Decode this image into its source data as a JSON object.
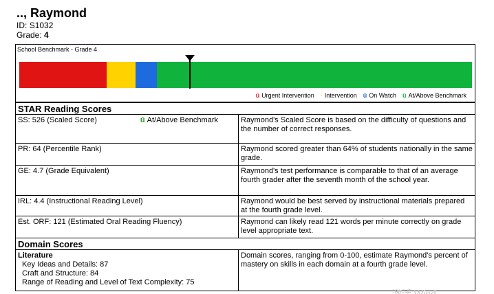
{
  "student": {
    "name": ".., Raymond",
    "id_label": "ID:",
    "id_value": "S1032",
    "grade_label": "Grade:",
    "grade_value": "4"
  },
  "benchmark": {
    "title": "School Benchmark - Grade 4",
    "segments": [
      {
        "name": "Urgent Intervention",
        "color": "#e11414"
      },
      {
        "name": "Intervention",
        "color": "#ffd200"
      },
      {
        "name": "On Watch",
        "color": "#1e6be0"
      },
      {
        "name": "At/Above Benchmark",
        "color": "#10b43c"
      }
    ],
    "legend": [
      {
        "glyph": "û",
        "label": "Urgent Intervention",
        "color": "#e11414"
      },
      {
        "glyph": "·",
        "label": "Intervention",
        "color": "#ffd200"
      },
      {
        "glyph": "û",
        "label": "On Watch",
        "color": "#1e6be0"
      },
      {
        "glyph": "û",
        "label": "At/Above Benchmark",
        "color": "#10b43c"
      }
    ]
  },
  "star": {
    "heading": "STAR Reading Scores",
    "rows": [
      {
        "left": "SS: 526 (Scaled Score)",
        "status_glyph": "û",
        "status": "At/Above Benchmark",
        "right": "Raymond's Scaled Score is based on the difficulty of questions and the number of correct responses."
      },
      {
        "left": "PR: 64 (Percentile Rank)",
        "right": "Raymond scored greater than 64% of students nationally in the same grade."
      },
      {
        "left": "GE: 4.7 (Grade Equivalent)",
        "right": "Raymond's test performance is comparable to that of an average fourth grader after the seventh month of the school year."
      },
      {
        "left": "IRL: 4.4 (Instructional Reading Level)",
        "right": "Raymond would be best served by instructional materials prepared at the fourth grade level."
      },
      {
        "left": "Est. ORF: 121 (Estimated Oral Reading Fluency)",
        "right": "Raymond can likely read 121 words per minute correctly on grade level appropriate text."
      }
    ]
  },
  "domain": {
    "heading": "Domain Scores",
    "title": "Literature",
    "items": [
      "Key Ideas and Details: 87",
      "Craft and Structure: 84",
      "Range of Reading and Level of Text Complexity: 75"
    ],
    "description": "Domain scores, ranging from 0-100, estimate Raymond's percent of mastery on skills in each domain at a fourth grade level."
  },
  "watermark": "激活 Wind"
}
